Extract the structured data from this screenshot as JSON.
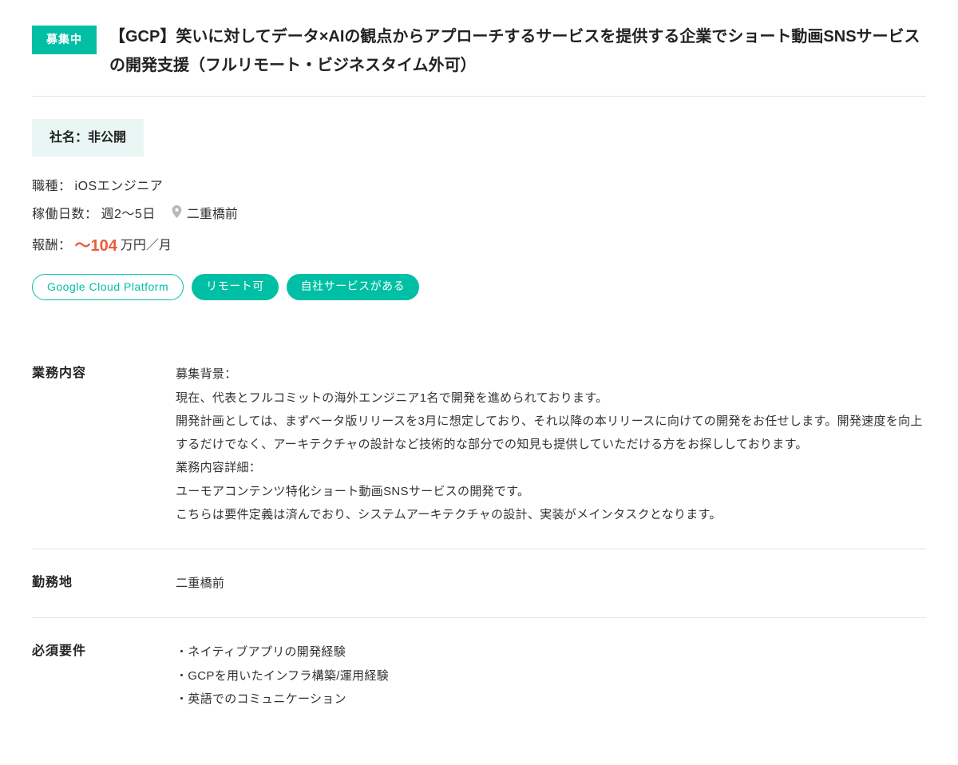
{
  "badge": "募集中",
  "title": "【GCP】笑いに対してデータ×AIの観点からアプローチするサービスを提供する企業でショート動画SNSサービスの開発支援（フルリモート・ビジネスタイム外可）",
  "company_label": "社名：非公開",
  "meta": {
    "role_label": "職種：",
    "role_value": "iOSエンジニア",
    "days_label": "稼働日数：",
    "days_value": "週2〜5日",
    "location": "二重橋前",
    "salary_label": "報酬：",
    "salary_value": "〜104",
    "salary_unit": "万円／月"
  },
  "tags": [
    {
      "text": "Google Cloud Platform",
      "style": "outline"
    },
    {
      "text": "リモート可",
      "style": "fill"
    },
    {
      "text": "自社サービスがある",
      "style": "fill"
    }
  ],
  "sections": {
    "job_label": "業務内容",
    "job_body_1": "募集背景：",
    "job_body_2": "現在、代表とフルコミットの海外エンジニア1名で開発を進められております。",
    "job_body_3": "開発計画としては、まずベータ版リリースを3月に想定しており、それ以降の本リリースに向けての開発をお任せします。開発速度を向上するだけでなく、アーキテクチャの設計など技術的な部分での知見も提供していただける方をお探ししております。",
    "job_body_4": "業務内容詳細：",
    "job_body_5": "ユーモアコンテンツ特化ショート動画SNSサービスの開発です。",
    "job_body_6": "こちらは要件定義は済んでおり、システムアーキテクチャの設計、実装がメインタスクとなります。",
    "location_label": "勤務地",
    "location_value": "二重橋前",
    "req_label": "必須要件",
    "req_1": "・ネイティブアプリの開発経験",
    "req_2": "・GCPを用いたインフラ構築/運用経験",
    "req_3": "・英語でのコミュニケーション"
  }
}
